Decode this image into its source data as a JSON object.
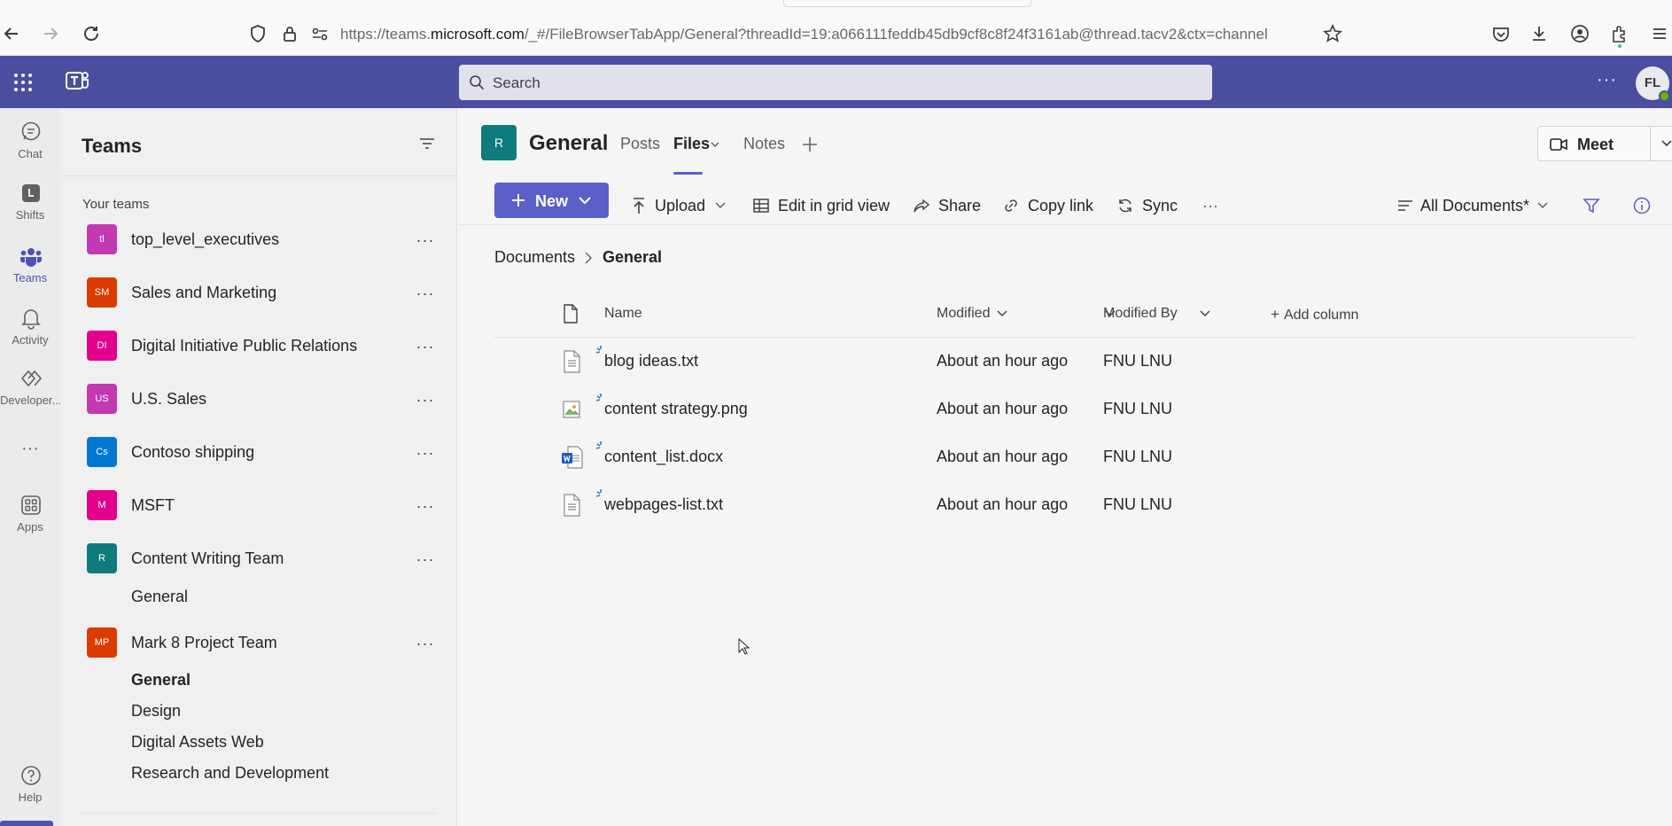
{
  "browser": {
    "url_prefix": "https://teams.",
    "url_domain": "microsoft.com",
    "url_rest": "/_#/FileBrowserTabApp/General?threadId=19:a066111feddb45db9cf8c8f24f3161ab@thread.tacv2&ctx=channel"
  },
  "header": {
    "search_placeholder": "Search",
    "more_label": "···",
    "avatar_initials": "FL"
  },
  "rail": {
    "items": [
      {
        "label": "Chat",
        "icon": "chat-icon"
      },
      {
        "label": "Shifts",
        "icon": "shifts-icon"
      },
      {
        "label": "Teams",
        "icon": "teams-icon"
      },
      {
        "label": "Activity",
        "icon": "bell-icon"
      },
      {
        "label": "Developer...",
        "icon": "developer-icon"
      },
      {
        "label": "···",
        "icon": "more-icon"
      },
      {
        "label": "Apps",
        "icon": "apps-icon"
      },
      {
        "label": "Help",
        "icon": "help-icon"
      }
    ]
  },
  "panel": {
    "title": "Teams",
    "section_label": "Your teams",
    "teams": [
      {
        "initials": "tl",
        "name": "top_level_executives",
        "color": "#c239b3"
      },
      {
        "initials": "SM",
        "name": "Sales and Marketing",
        "color": "#da3b01"
      },
      {
        "initials": "DI",
        "name": "Digital Initiative Public Relations",
        "color": "#e3008c"
      },
      {
        "initials": "US",
        "name": "U.S. Sales",
        "color": "#c239b3"
      },
      {
        "initials": "Cs",
        "name": "Contoso shipping",
        "color": "#0078d4"
      },
      {
        "initials": "M",
        "name": "MSFT",
        "color": "#e3008c"
      },
      {
        "initials": "R",
        "name": "Content Writing Team",
        "color": "#0f7b7c"
      },
      {
        "initials": "MP",
        "name": "Mark 8 Project Team",
        "color": "#da3b01"
      }
    ],
    "content_writing_channels": [
      "General"
    ],
    "mark8_channels": [
      "General",
      "Design",
      "Digital Assets Web",
      "Research and Development"
    ],
    "more_label": "···"
  },
  "channel": {
    "avatar_initial": "R",
    "title": "General",
    "tabs": [
      "Posts",
      "Files",
      "Notes"
    ],
    "active_tab": "Files",
    "meet_label": "Meet"
  },
  "toolbar": {
    "new_label": "New",
    "upload_label": "Upload",
    "grid_label": "Edit in grid view",
    "share_label": "Share",
    "copy_link_label": "Copy link",
    "sync_label": "Sync",
    "more_label": "···",
    "view_label": "All Documents*"
  },
  "breadcrumb": {
    "root": "Documents",
    "current": "General"
  },
  "table": {
    "columns": {
      "name": "Name",
      "modified": "Modified",
      "modified_by": "Modified By",
      "add_column": "Add column"
    },
    "rows": [
      {
        "name": "blog ideas.txt",
        "modified": "About an hour ago",
        "modified_by": "FNU LNU",
        "icon": "text-file-icon"
      },
      {
        "name": "content strategy.png",
        "modified": "About an hour ago",
        "modified_by": "FNU LNU",
        "icon": "image-file-icon"
      },
      {
        "name": "content_list.docx",
        "modified": "About an hour ago",
        "modified_by": "FNU LNU",
        "icon": "word-file-icon"
      },
      {
        "name": "webpages-list.txt",
        "modified": "About an hour ago",
        "modified_by": "FNU LNU",
        "icon": "text-file-icon"
      }
    ]
  },
  "colors": {
    "brand": "#4b4e9e",
    "accent": "#5b5fc7",
    "active_rail": "#4f52b2"
  }
}
